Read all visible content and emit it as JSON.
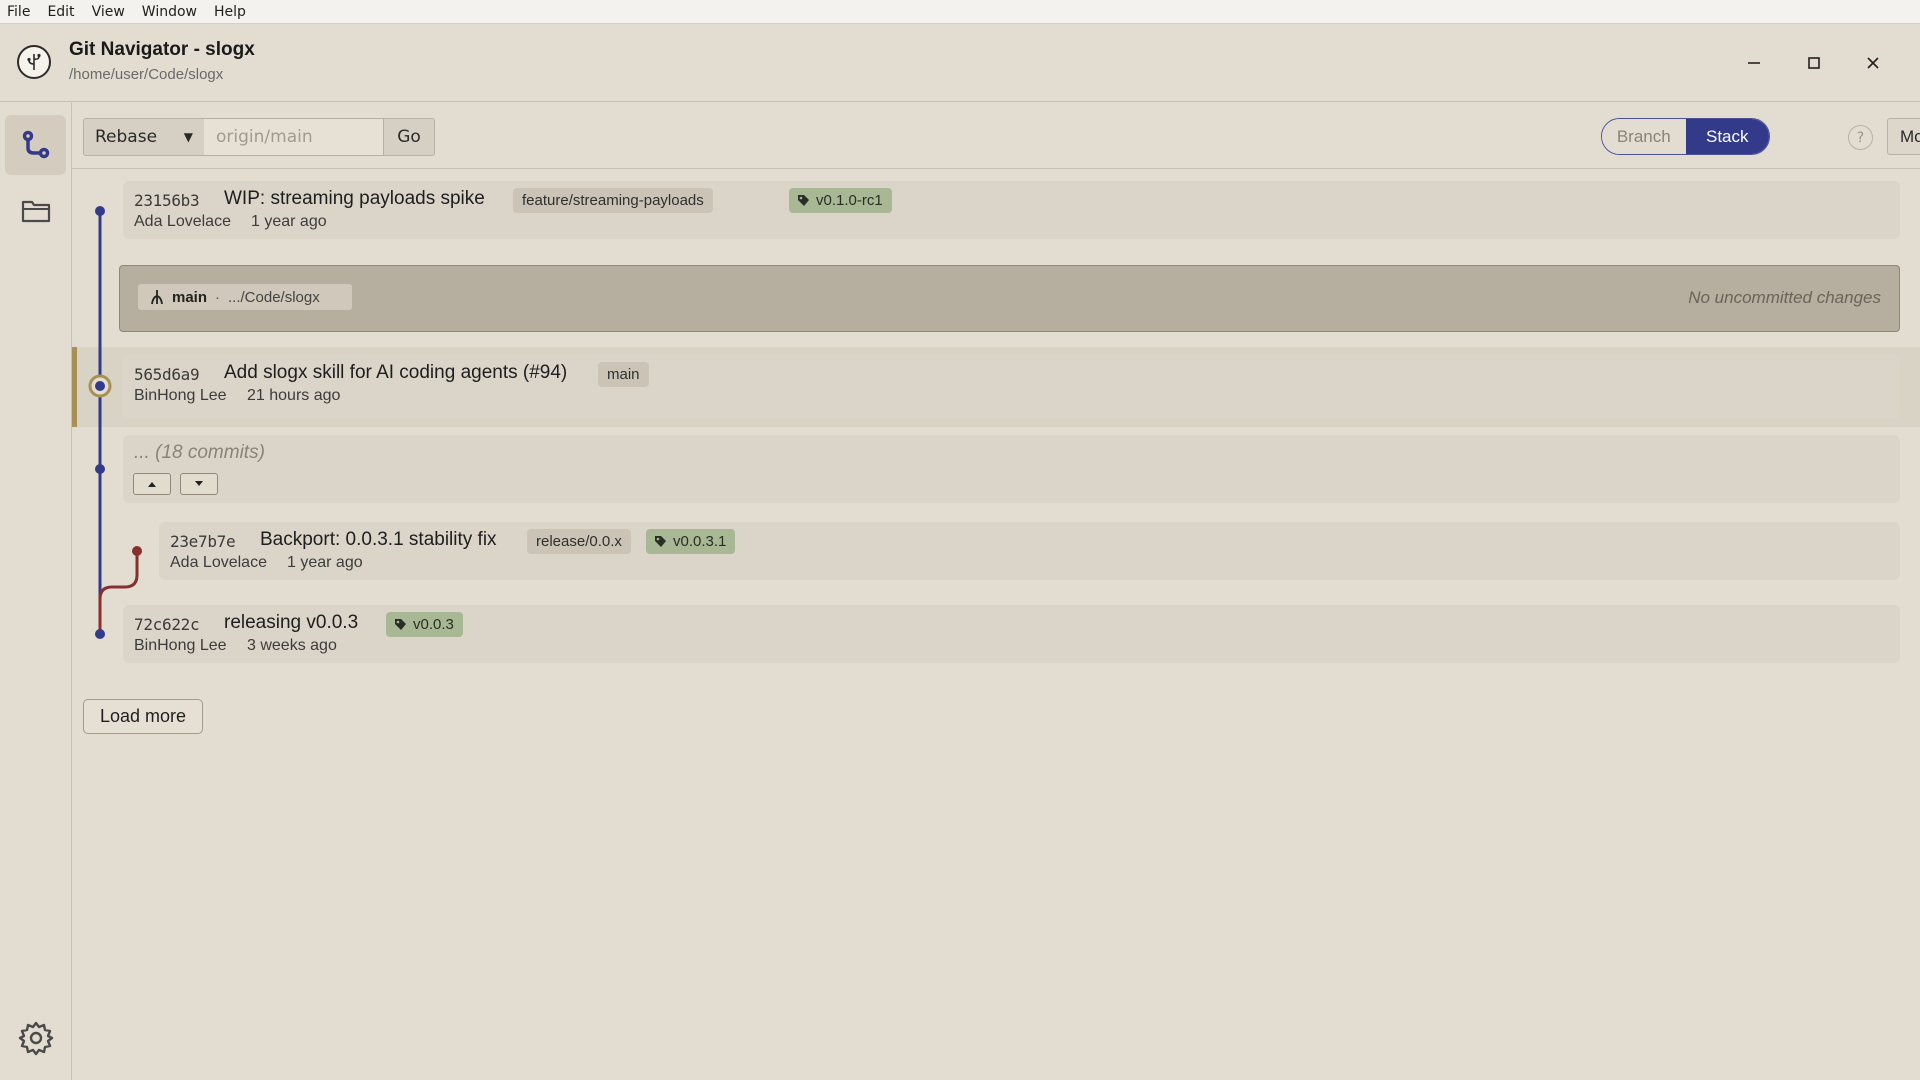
{
  "menu": [
    "File",
    "Edit",
    "View",
    "Window",
    "Help"
  ],
  "window": {
    "title": "Git Navigator - slogx",
    "path": "/home/user/Code/slogx"
  },
  "toolbar": {
    "mode_value": "Rebase",
    "ref_placeholder": "origin/main",
    "go_label": "Go",
    "branch_label": "Branch",
    "stack_label": "Stack",
    "active_view": "Stack",
    "help_label": "?",
    "more_label": "More"
  },
  "commits": [
    {
      "sha": "23156b3",
      "message": "WIP: streaming payloads spike",
      "author": "Ada Lovelace",
      "time": "1 year ago",
      "branches": [
        "feature/streaming-payloads"
      ],
      "tags": [
        "v0.1.0-rc1"
      ]
    },
    {
      "sha": "565d6a9",
      "message": "Add slogx skill for AI coding agents (#94)",
      "author": "BinHong Lee",
      "time": "21 hours ago",
      "branches": [
        "main"
      ],
      "tags": []
    },
    {
      "sha": "23e7b7e",
      "message": "Backport: 0.0.3.1 stability fix",
      "author": "Ada Lovelace",
      "time": "1 year ago",
      "branches": [
        "release/0.0.x"
      ],
      "tags": [
        "v0.0.3.1"
      ]
    },
    {
      "sha": "72c622c",
      "message": "releasing v0.0.3",
      "author": "BinHong Lee",
      "time": "3 weeks ago",
      "branches": [],
      "tags": [
        "v0.0.3"
      ]
    }
  ],
  "worktree": {
    "branch": "main",
    "separator": "·",
    "path": ".../Code/slogx",
    "status": "No uncommitted changes"
  },
  "collapsed": {
    "label": "... (18 commits)"
  },
  "load_more_label": "Load more",
  "colors": {
    "graph_main": "#333a8a",
    "graph_branch": "#8a2f2f",
    "head_accent": "#a78f55",
    "tag_bg": "#a8b794",
    "stack_active": "#333a8a"
  }
}
